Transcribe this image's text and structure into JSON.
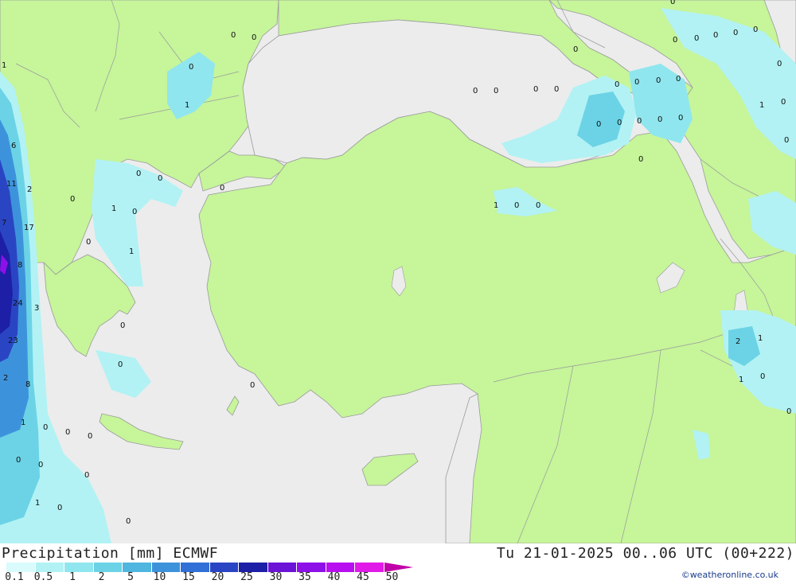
{
  "title": "Precipitation [mm] ECMWF",
  "datetime": "Tu 21-01-2025 00..06 UTC (00+222)",
  "credit": "©weatheronline.co.uk",
  "colors": {
    "land": "#c6f59a",
    "sea": "#ececec",
    "border": "#9a9a9a",
    "legend": [
      "#d9fbfb",
      "#b2f2f4",
      "#90e6ee",
      "#6cd3e6",
      "#4eb6df",
      "#3d93db",
      "#3170d6",
      "#2a45c4",
      "#1d1fa6",
      "#6b14d8",
      "#8e10e8",
      "#b80ff0",
      "#e11ae8",
      "#c000a8"
    ]
  },
  "legend": {
    "labels": [
      "0.1",
      "0.5",
      "1",
      "2",
      "5",
      "10",
      "15",
      "20",
      "25",
      "30",
      "35",
      "40",
      "45",
      "50"
    ]
  },
  "values": [
    {
      "t": "0"
    },
    {
      "t": "0"
    },
    {
      "t": "1"
    },
    {
      "t": "0"
    },
    {
      "t": "1"
    },
    {
      "t": "6"
    },
    {
      "t": "11"
    },
    {
      "t": "2"
    },
    {
      "t": "0"
    },
    {
      "t": "0"
    },
    {
      "t": "0"
    },
    {
      "t": "1"
    },
    {
      "t": "0"
    },
    {
      "t": "7"
    },
    {
      "t": "17"
    },
    {
      "t": "0"
    },
    {
      "t": "1"
    },
    {
      "t": "8"
    },
    {
      "t": "24"
    },
    {
      "t": "3"
    },
    {
      "t": "23"
    },
    {
      "t": "0"
    },
    {
      "t": "0"
    },
    {
      "t": "2"
    },
    {
      "t": "8"
    },
    {
      "t": "0"
    },
    {
      "t": "1"
    },
    {
      "t": "0"
    },
    {
      "t": "0"
    },
    {
      "t": "0"
    },
    {
      "t": "0"
    },
    {
      "t": "0"
    },
    {
      "t": "0"
    },
    {
      "t": "1"
    },
    {
      "t": "0"
    },
    {
      "t": "0"
    },
    {
      "t": "0"
    },
    {
      "t": "0"
    },
    {
      "t": "0"
    },
    {
      "t": "0"
    },
    {
      "t": "0"
    },
    {
      "t": "0"
    },
    {
      "t": "0"
    },
    {
      "t": "0"
    },
    {
      "t": "0"
    },
    {
      "t": "0"
    },
    {
      "t": "0"
    },
    {
      "t": "0"
    },
    {
      "t": "0"
    },
    {
      "t": "0"
    },
    {
      "t": "0"
    },
    {
      "t": "0"
    },
    {
      "t": "1"
    },
    {
      "t": "0"
    },
    {
      "t": "0"
    },
    {
      "t": "0"
    },
    {
      "t": "0"
    },
    {
      "t": "0"
    },
    {
      "t": "0"
    },
    {
      "t": "0"
    },
    {
      "t": "0"
    },
    {
      "t": "0"
    },
    {
      "t": "1"
    },
    {
      "t": "0"
    },
    {
      "t": "0"
    },
    {
      "t": "2"
    },
    {
      "t": "1"
    },
    {
      "t": "1"
    },
    {
      "t": "0"
    },
    {
      "t": "0"
    }
  ]
}
